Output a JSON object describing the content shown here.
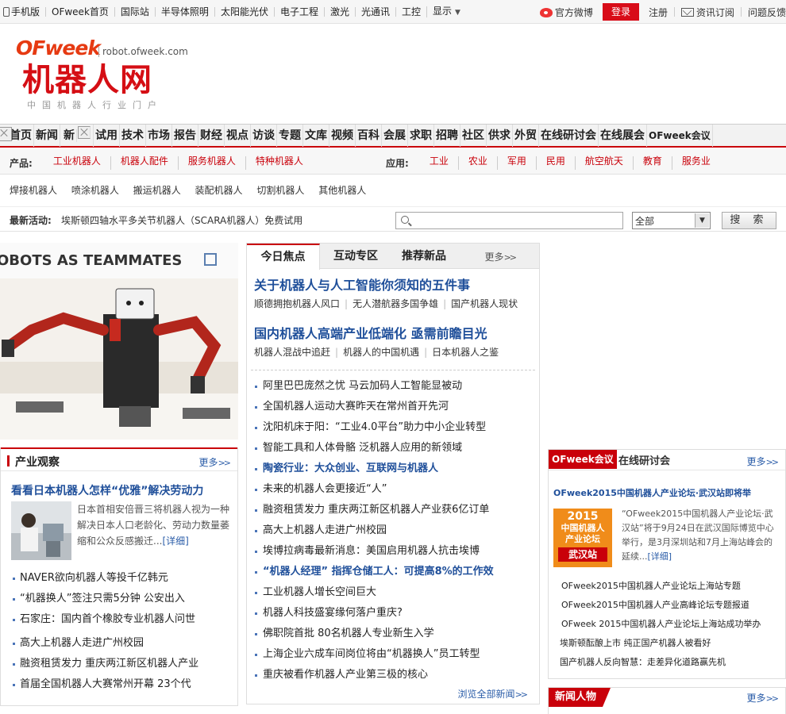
{
  "topbar": {
    "left_items": [
      "手机版",
      "OFweek首页",
      "国际站",
      "半导体照明",
      "太阳能光伏",
      "电子工程",
      "激光",
      "光通讯",
      "工控",
      "显示"
    ],
    "weibo": "官方微博",
    "login": "登录",
    "register": "注册",
    "subscribe": "资讯订阅",
    "feedback": "问题反馈"
  },
  "logo": {
    "brand": "OFweek",
    "url": "robot.ofweek.com",
    "name": "机器人网",
    "tagline": "中国机器人行业门户"
  },
  "mainnav": {
    "items": [
      "首页",
      "新闻",
      "新",
      "试用",
      "技术",
      "市场",
      "报告",
      "财经",
      "视点",
      "访谈",
      "专题",
      "文库",
      "视频",
      "百科",
      "会展",
      "求职",
      "招聘",
      "社区",
      "供求",
      "外贸",
      "在线研讨会",
      "在线展会",
      "OFweek会议"
    ]
  },
  "products": {
    "label": "产品:",
    "items": [
      "工业机器人",
      "机器人配件",
      "服务机器人",
      "特种机器人"
    ]
  },
  "applications": {
    "label": "应用:",
    "items": [
      "工业",
      "农业",
      "军用",
      "民用",
      "航空航天",
      "教育",
      "服务业"
    ]
  },
  "subcats": [
    "焊接机器人",
    "喷涂机器人",
    "搬运机器人",
    "装配机器人",
    "切割机器人",
    "其他机器人"
  ],
  "activity": {
    "label": "最新活动:",
    "text": "埃斯顿四轴水平多关节机器人（SCARA机器人）免费试用"
  },
  "search": {
    "select_value": "全部",
    "button": "搜 索"
  },
  "hero": {
    "banner_text": "OBOTS AS TEAMMATES"
  },
  "industry": {
    "title": "产业观察",
    "more": "更多",
    "headline": "看看日本机器人怎样“优雅”解决劳动力",
    "desc": "日本首相安倍晋三将机器人视为一种解决日本人口老龄化、劳动力数量萎缩和公众反感搬迁...",
    "detail": "[详细]",
    "list": [
      "NAVER欲向机器人等投千亿韩元",
      "“机器换人”签注只需5分钟 公安出入",
      "石家庄：国内首个橡胶专业机器人问世",
      "高大上机器人走进广州校园",
      "融资租赁发力 重庆两江新区机器人产业",
      "首届全国机器人大赛常州开幕 23个代"
    ]
  },
  "center": {
    "tabs": [
      "今日焦点",
      "互动专区",
      "推荐新品"
    ],
    "more": "更多",
    "headline1": "关于机器人与人工智能你须知的五件事",
    "sub1": [
      "顺德拥抱机器人风口",
      "无人潜航器多国争雄",
      "国产机器人现状"
    ],
    "headline2": "国内机器人高端产业低端化 亟需前瞻目光",
    "sub2": [
      "机器人混战中追赶",
      "机器人的中国机遇",
      "日本机器人之鉴"
    ],
    "list": [
      {
        "text": "阿里巴巴庞然之忧 马云加码人工智能显被动",
        "bold": false
      },
      {
        "text": "全国机器人运动大赛昨天在常州首开先河",
        "bold": false
      },
      {
        "text": "沈阳机床于阳：“工业4.0平台”助力中小企业转型",
        "bold": false
      },
      {
        "text": "智能工具和人体骨骼 泛机器人应用的新领域",
        "bold": false
      },
      {
        "text": "陶瓷行业：大众创业、互联网与机器人",
        "bold": true
      },
      {
        "text": "未来的机器人会更接近“人”",
        "bold": false
      },
      {
        "text": "融资租赁发力 重庆两江新区机器人产业获6亿订单",
        "bold": false
      },
      {
        "text": "高大上机器人走进广州校园",
        "bold": false
      },
      {
        "text": "埃博拉病毒最新消息：美国启用机器人抗击埃博",
        "bold": false
      },
      {
        "text": "“机器人经理” 指挥仓储工人：可提高8%的工作效",
        "bold": true
      },
      {
        "text": "工业机器人增长空间巨大",
        "bold": false
      },
      {
        "text": "机器人科技盛宴缘何落户重庆?",
        "bold": false
      },
      {
        "text": "佛职院首批 80名机器人专业新生入学",
        "bold": false
      },
      {
        "text": "上海企业六成车间岗位将由“机器换人”员工转型",
        "bold": false
      },
      {
        "text": "重庆被看作机器人产业第三极的核心",
        "bold": false
      }
    ],
    "browse_all": "浏览全部新闻"
  },
  "meeting": {
    "badge": "OFweek会议",
    "title2": "在线研讨会",
    "more": "更多",
    "headline": "OFweek2015中国机器人产业论坛·武汉站即将举",
    "img_year": "2015",
    "img_line1": "中国机器人",
    "img_line2": "产业论坛",
    "img_city": "武汉站",
    "desc": "“OFweek2015中国机器人产业论坛·武汉站”将于9月24日在武汉国际博览中心举行，是3月深圳站和7月上海站峰会的延续...",
    "detail": "[详细]",
    "list": [
      "OFweek2015中国机器人产业论坛上海站专题",
      "OFweek2015中国机器人产业高峰论坛专题报道",
      "OFweek 2015中国机器人产业论坛上海站成功举办",
      "埃斯顿酝酿上市 纯正国产机器人被看好",
      "国产机器人反向智慧：走差异化道路赢先机"
    ]
  },
  "people": {
    "title": "新闻人物",
    "more": "更多"
  }
}
